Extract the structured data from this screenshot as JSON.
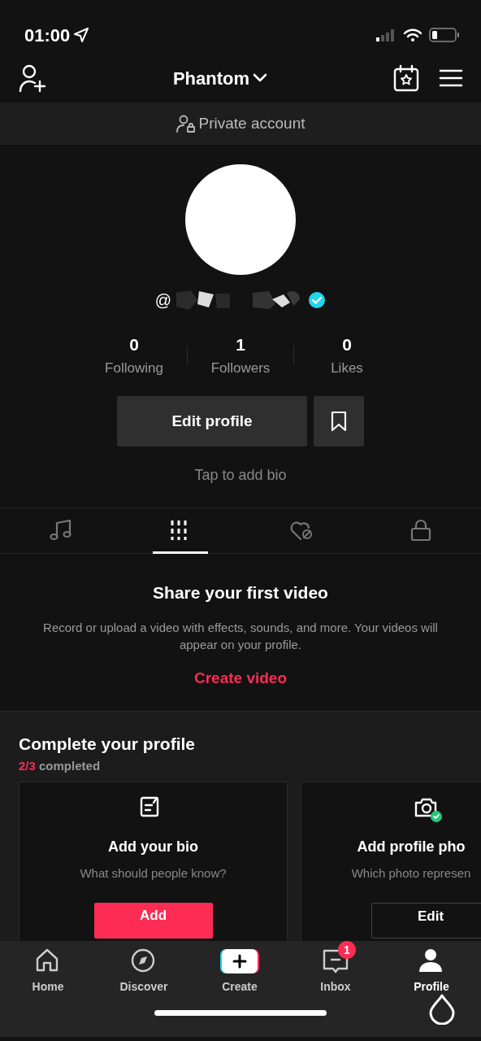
{
  "status_bar": {
    "time": "01:00"
  },
  "header": {
    "title": "Phantom"
  },
  "private_banner": {
    "text": "Private account"
  },
  "profile": {
    "handle_prefix": "@",
    "verified": true
  },
  "stats": [
    {
      "value": "0",
      "label": "Following"
    },
    {
      "value": "1",
      "label": "Followers"
    },
    {
      "value": "0",
      "label": "Likes"
    }
  ],
  "edit_button": "Edit profile",
  "bio_placeholder": "Tap to add bio",
  "tabs": [
    {
      "kind": "music",
      "selected": false
    },
    {
      "kind": "grid",
      "selected": true
    },
    {
      "kind": "liked",
      "selected": false
    },
    {
      "kind": "private",
      "selected": false
    }
  ],
  "empty_state": {
    "title": "Share your first video",
    "text": "Record or upload a video with effects, sounds, and more. Your videos will appear on your profile.",
    "action": "Create video"
  },
  "complete_profile": {
    "title": "Complete your profile",
    "done": "2/3",
    "progress_text": "completed",
    "cards": [
      {
        "kind": "bio",
        "title": "Add your bio",
        "text": "What should people know?",
        "button": "Add",
        "done": false
      },
      {
        "kind": "photo",
        "title": "Add profile pho",
        "text": "Which photo represen",
        "button": "Edit",
        "done": true
      }
    ]
  },
  "bottom_nav": [
    {
      "kind": "home",
      "label": "Home",
      "selected": false
    },
    {
      "kind": "discover",
      "label": "Discover",
      "selected": false
    },
    {
      "kind": "create",
      "label": "Create",
      "selected": false
    },
    {
      "kind": "inbox",
      "label": "Inbox",
      "selected": false,
      "badge": "1"
    },
    {
      "kind": "profile",
      "label": "Profile",
      "selected": true
    }
  ]
}
